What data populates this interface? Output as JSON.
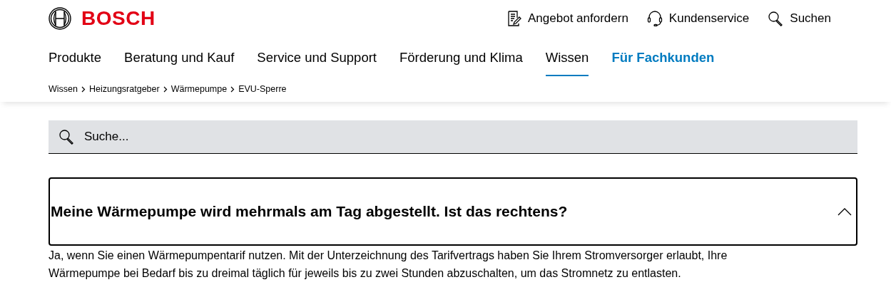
{
  "header": {
    "brand": "BOSCH",
    "utility_links": [
      {
        "kind": "quote",
        "label": "Angebot anfordern"
      },
      {
        "kind": "support",
        "label": "Kundenservice"
      },
      {
        "kind": "search",
        "label": "Suchen"
      }
    ],
    "nav": [
      {
        "label": "Produkte",
        "selected": false,
        "kind": "plain"
      },
      {
        "label": "Beratung und Kauf",
        "selected": false,
        "kind": "plain"
      },
      {
        "label": "Service und Support",
        "selected": false,
        "kind": "plain"
      },
      {
        "label": "Förderung und Klima",
        "selected": false,
        "kind": "plain"
      },
      {
        "label": "Wissen",
        "selected": true,
        "kind": "plain"
      },
      {
        "label": "Für Fachkunden",
        "selected": false,
        "kind": "accent"
      }
    ],
    "breadcrumb": [
      "Wissen",
      "Heizungsratgeber",
      "Wärmepumpe",
      "EVU-Sperre"
    ]
  },
  "search": {
    "placeholder": "Suche..."
  },
  "faq": {
    "question": "Meine Wärmepumpe wird mehrmals am Tag abgestellt. Ist das rechtens?",
    "expanded": true,
    "answer": "Ja, wenn Sie einen Wärmepumpentarif nutzen. Mit der Unterzeichnung des Tarifvertrags haben Sie Ihrem Stromversorger erlaubt, Ihre Wärmepumpe bei Bedarf bis zu dreimal täglich für jeweils bis zu zwei Stunden abzuschalten, um das Stromnetz zu entlasten."
  }
}
